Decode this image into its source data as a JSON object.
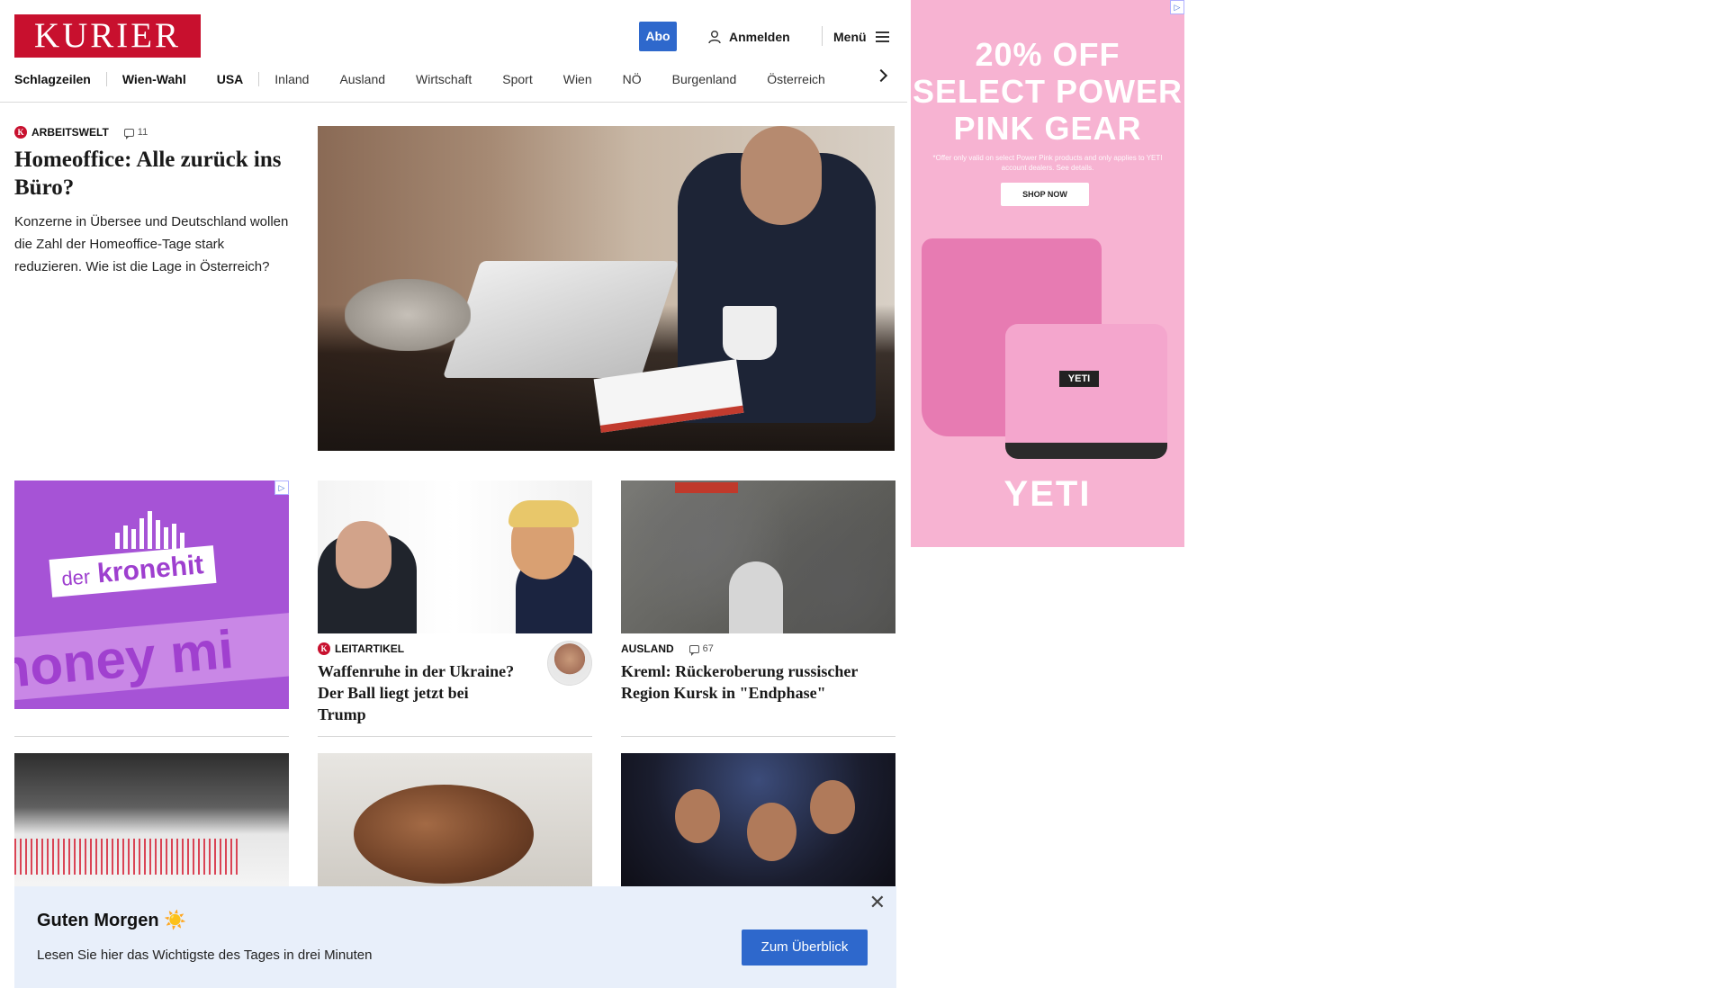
{
  "header": {
    "logo": "KURIER",
    "abo_label": "Abo",
    "login_label": "Anmelden",
    "menu_label": "Menü"
  },
  "nav": {
    "items": [
      {
        "label": "Schlagzeilen",
        "bold": true
      },
      {
        "label": "Wien-Wahl",
        "bold": true
      },
      {
        "label": "USA",
        "bold": true
      },
      {
        "label": "Inland",
        "bold": false
      },
      {
        "label": "Ausland",
        "bold": false
      },
      {
        "label": "Wirtschaft",
        "bold": false
      },
      {
        "label": "Sport",
        "bold": false
      },
      {
        "label": "Wien",
        "bold": false
      },
      {
        "label": "NÖ",
        "bold": false
      },
      {
        "label": "Burgenland",
        "bold": false
      },
      {
        "label": "Österreich",
        "bold": false
      }
    ]
  },
  "lead": {
    "kicker": "ARBEITSWELT",
    "comment_count": "11",
    "title": "Homeoffice: Alle zurück ins Büro?",
    "teaser": "Konzerne in Übersee und Deutschland wollen die Zahl der Homeoffice-Tage stark reduzieren. Wie ist die Lage in Österreich?"
  },
  "cards": [
    {
      "kicker": "LEITARTIKEL",
      "title": "Waffenruhe in der Ukraine? Der Ball liegt jetzt bei Trump",
      "premium": true
    },
    {
      "kicker": "AUSLAND",
      "comment_count": "67",
      "title": "Kreml: Rückeroberung russischer Region Kursk in \"Endphase\""
    }
  ],
  "ads": {
    "kronehit": {
      "brand_prefix": "der",
      "brand_name": "kronehit",
      "band_text": "honey mi"
    },
    "yeti": {
      "headline_line1": "20% OFF",
      "headline_line2": "SELECT POWER",
      "headline_line3": "PINK GEAR",
      "fine_print": "*Offer only valid on select Power Pink products and only applies to YETI account dealers. See details.",
      "button": "SHOP NOW",
      "badge": "YETI",
      "brand": "YETI"
    }
  },
  "banner": {
    "title": "Guten Morgen ☀️",
    "text": "Lesen Sie hier das Wichtigste des Tages in drei Minuten",
    "button": "Zum Überblick",
    "close_symbol": "✕"
  },
  "colors": {
    "brand_red": "#c8102e",
    "accent_blue": "#2e68cc",
    "banner_bg": "#e8effa",
    "kronehit_purple": "#a653d6",
    "yeti_pink": "#f7b3d2"
  },
  "icons": [
    "user-icon",
    "hamburger-icon",
    "chevron-right-icon",
    "comment-icon",
    "close-icon",
    "ad-choices-icon"
  ]
}
